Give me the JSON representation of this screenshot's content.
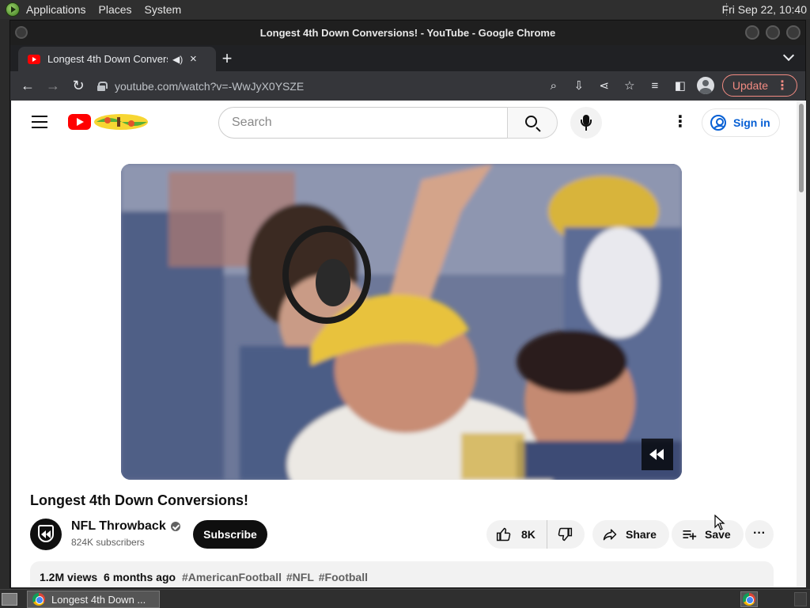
{
  "os": {
    "menus": [
      "Applications",
      "Places",
      "System"
    ],
    "clock": "Fri Sep 22, 10:40"
  },
  "window": {
    "title": "Longest 4th Down Conversions! - YouTube - Google Chrome"
  },
  "tab": {
    "title": "Longest 4th Down Conversions! - YouTube",
    "close": "×",
    "new_tab": "+"
  },
  "toolbar": {
    "url": "youtube.com/watch?v=-WwJyX0YSZE",
    "update_label": "Update",
    "back": "←",
    "forward": "→",
    "reload": "↻"
  },
  "youtube": {
    "search_placeholder": "Search",
    "sign_in": "Sign in",
    "more": "⋮"
  },
  "video": {
    "title": "Longest 4th Down Conversions!",
    "channel": "NFL Throwback",
    "subscribers": "824K subscribers",
    "subscribe": "Subscribe",
    "likes": "8K",
    "share": "Share",
    "save": "Save",
    "more_actions": "···",
    "views": "1.2M views",
    "age": "6 months ago",
    "tags": [
      "#AmericanFootball",
      "#NFL",
      "#Football"
    ]
  },
  "taskbar": {
    "item_label": "Longest 4th Down ..."
  },
  "colors": {
    "youtube_red": "#ff0000",
    "link_blue": "#065fd4",
    "update_accent": "#f28b82"
  }
}
